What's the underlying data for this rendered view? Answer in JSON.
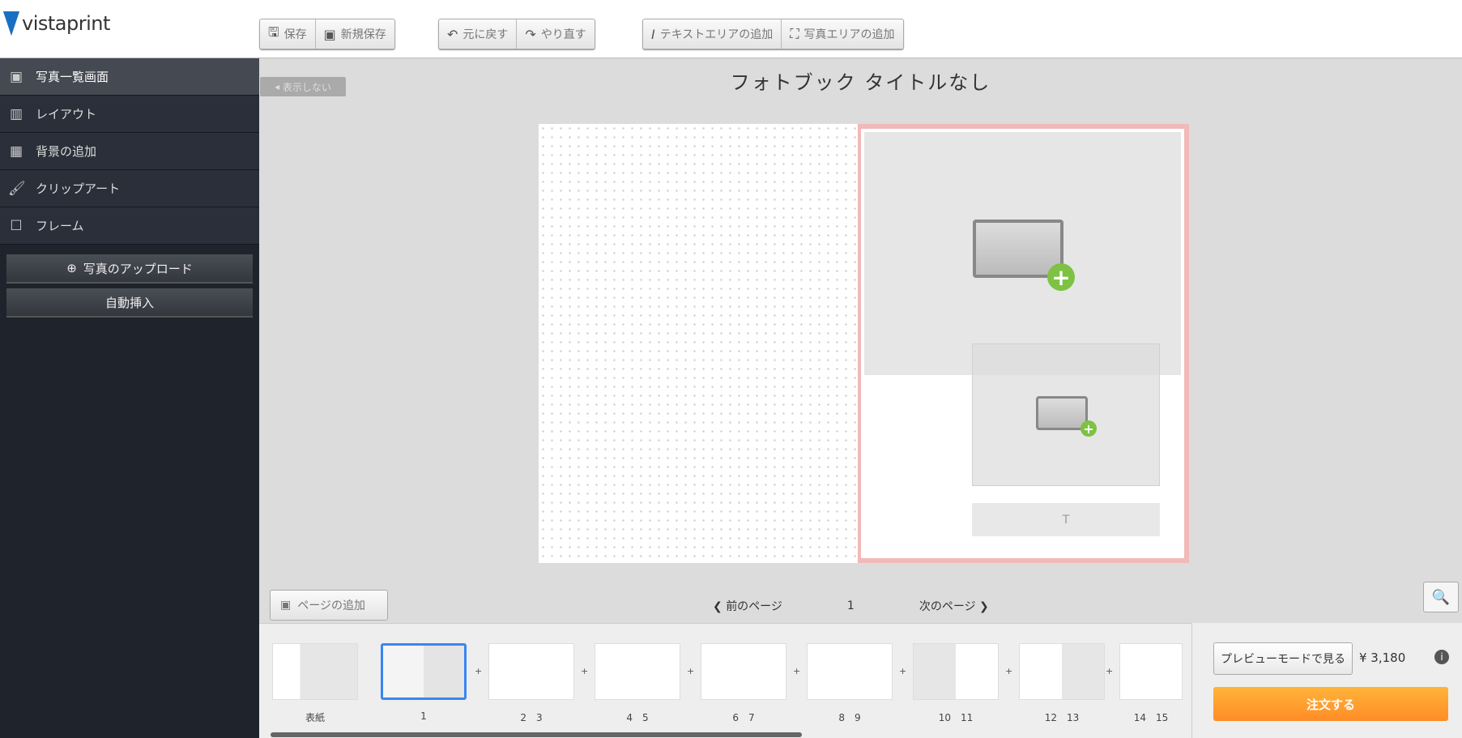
{
  "brand": {
    "logo_text": "vistaprint",
    "logo_color": "#1a6fc2"
  },
  "toolbar": {
    "save": "保存",
    "save_new": "新規保存",
    "undo": "元に戻す",
    "redo": "やり直す",
    "add_text": "テキストエリアの追加",
    "add_photo": "写真エリアの追加"
  },
  "sidebar": {
    "items": [
      {
        "label": "写真一覧画面",
        "icon": "photo-list-icon"
      },
      {
        "label": "レイアウト",
        "icon": "layout-icon"
      },
      {
        "label": "背景の追加",
        "icon": "background-icon"
      },
      {
        "label": "クリップアート",
        "icon": "brush-icon"
      },
      {
        "label": "フレーム",
        "icon": "frame-icon"
      }
    ],
    "upload": "写真のアップロード",
    "auto_insert": "自動挿入"
  },
  "editor": {
    "hide_label": "表示しない",
    "title": "フォトブック タイトルなし",
    "text_placeholder_icon": "T"
  },
  "pagenav": {
    "add_page": "ページの追加",
    "prev": "前のページ",
    "current": "1",
    "next": "次のページ"
  },
  "thumbnails": [
    {
      "label": "表紙"
    },
    {
      "label": "1"
    },
    {
      "label": "2　3"
    },
    {
      "label": "4　5"
    },
    {
      "label": "6　7"
    },
    {
      "label": "8　9"
    },
    {
      "label": "10　11"
    },
    {
      "label": "12　13"
    },
    {
      "label": "14　15"
    }
  ],
  "order": {
    "preview": "プレビューモードで見る",
    "price": "¥ 3,180",
    "order_button": "注文する",
    "accent": "#ff9a2e"
  }
}
